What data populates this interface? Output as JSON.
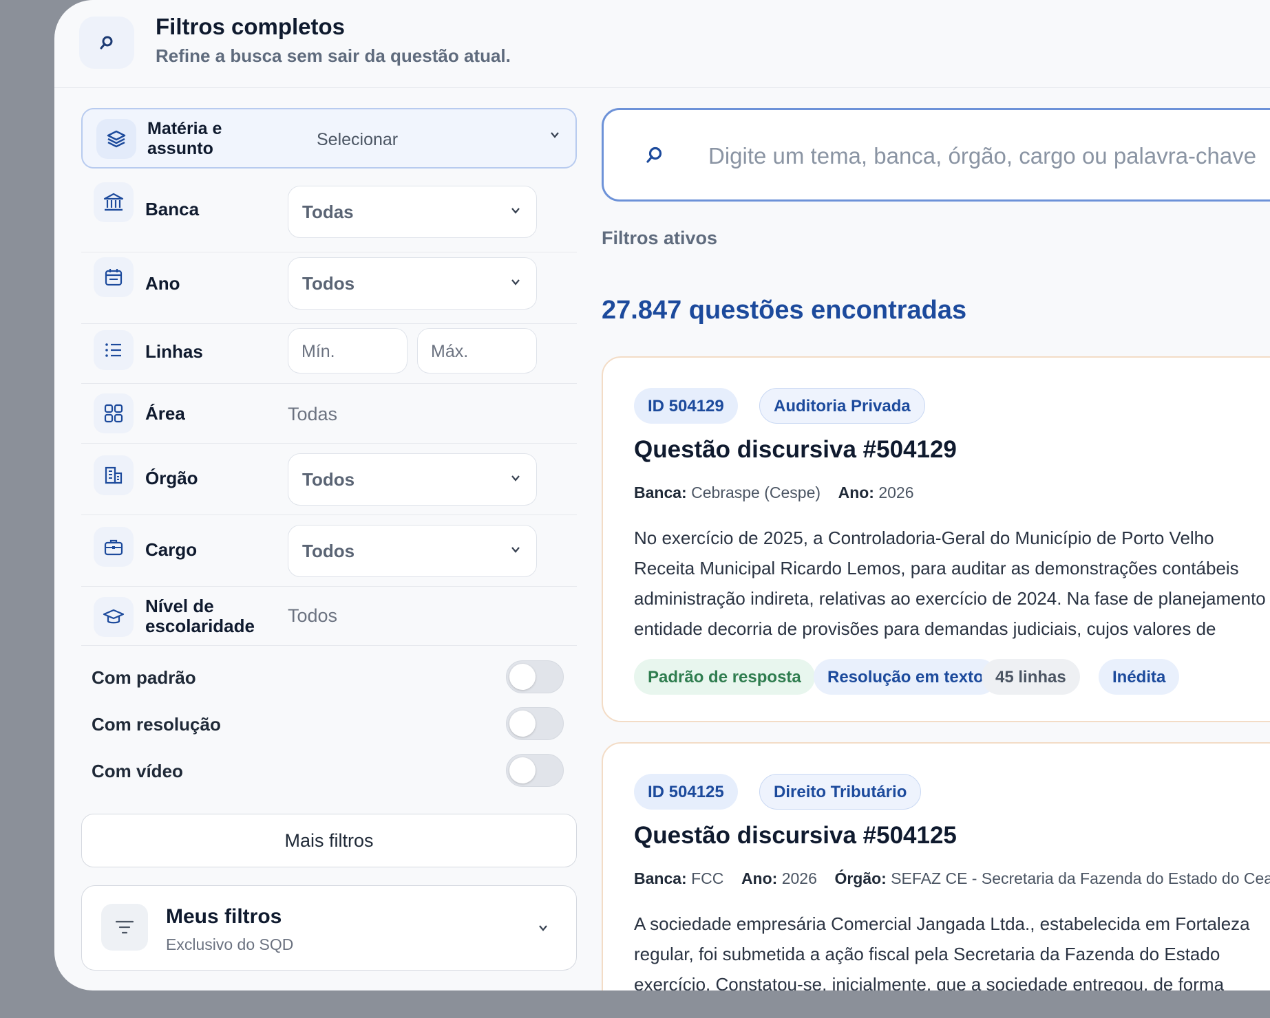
{
  "header": {
    "title": "Filtros completos",
    "subtitle": "Refine a busca sem sair da questão atual."
  },
  "sidebar": {
    "materia": {
      "label": "Matéria e assunto",
      "value": "Selecionar",
      "icon": "layers-icon"
    },
    "banca": {
      "label": "Banca",
      "value": "Todas",
      "icon": "bank-icon"
    },
    "ano": {
      "label": "Ano",
      "value": "Todos",
      "icon": "calendar-icon"
    },
    "linhas": {
      "label": "Linhas",
      "min_placeholder": "Mín.",
      "max_placeholder": "Máx.",
      "icon": "list-icon"
    },
    "area": {
      "label": "Área",
      "value": "Todas",
      "icon": "grid-icon"
    },
    "orgao": {
      "label": "Órgão",
      "value": "Todos",
      "icon": "building-icon"
    },
    "cargo": {
      "label": "Cargo",
      "value": "Todos",
      "icon": "briefcase-icon"
    },
    "nivel": {
      "label": "Nível de escolaridade",
      "value": "Todos",
      "icon": "graduation-cap-icon"
    },
    "toggles": [
      {
        "label": "Com padrão",
        "on": false
      },
      {
        "label": "Com resolução",
        "on": false
      },
      {
        "label": "Com vídeo",
        "on": false
      }
    ],
    "mais_filtros": "Mais filtros",
    "meus_filtros": {
      "title": "Meus filtros",
      "subtitle": "Exclusivo do SQD",
      "icon": "filter-icon"
    }
  },
  "main": {
    "search_placeholder": "Digite um tema, banca, órgão, cargo ou palavra-chave",
    "filtros_ativos": "Filtros ativos",
    "result_count": "27.847 questões encontradas",
    "cards": [
      {
        "id": "ID 504129",
        "subject": "Auditoria Privada",
        "title": "Questão discursiva #504129",
        "meta": [
          {
            "label": "Banca:",
            "value": "Cebraspe (Cespe)"
          },
          {
            "label": "Ano:",
            "value": "2026"
          }
        ],
        "body": [
          "No exercício de 2025, a Controladoria-Geral do Município de Porto Velho",
          "Receita Municipal Ricardo Lemos, para auditar as demonstrações contábeis",
          "administração indireta, relativas ao exercício de 2024. Na fase de planejamento",
          "entidade decorria de provisões para demandas judiciais, cujos valores de"
        ],
        "tags": [
          "Padrão de resposta",
          "Resolução em texto",
          "45 linhas",
          "Inédita"
        ]
      },
      {
        "id": "ID 504125",
        "subject": "Direito Tributário",
        "title": "Questão discursiva #504125",
        "meta": [
          {
            "label": "Banca:",
            "value": "FCC"
          },
          {
            "label": "Ano:",
            "value": "2026"
          },
          {
            "label": "Órgão:",
            "value": "SEFAZ CE - Secretaria da Fazenda do Estado do Ceará"
          }
        ],
        "body": [
          "A sociedade empresária Comercial Jangada Ltda., estabelecida em Fortaleza",
          "regular, foi submetida a ação fiscal pela Secretaria da Fazenda do Estado",
          "exercício. Constatou-se, inicialmente, que a sociedade entregou, de forma"
        ]
      }
    ]
  },
  "colors": {
    "accent": "#1c4a9c",
    "search_border": "#6d92d8",
    "card_border": "#f3dcc6",
    "tag_green": "#2f7d4f"
  }
}
